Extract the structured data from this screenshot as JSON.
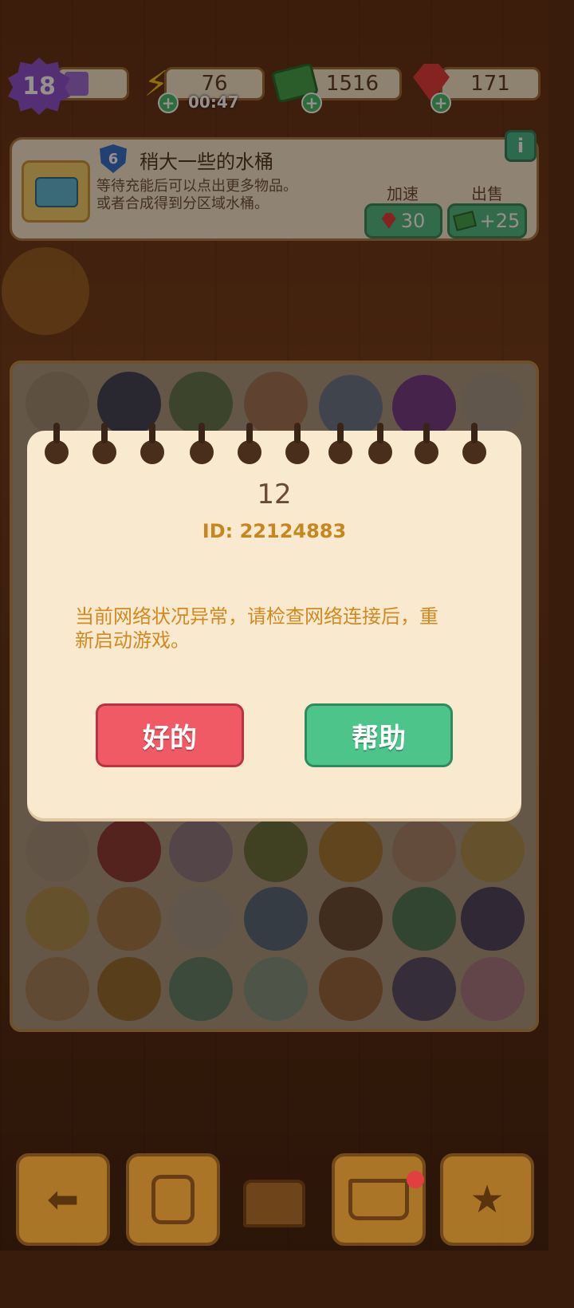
{
  "stats": {
    "level": "18",
    "energy": "76",
    "energy_timer": "00:47",
    "cash": "1516",
    "gems": "171"
  },
  "task": {
    "level": "6",
    "title": "稍大一些的水桶",
    "description_line1": "等待充能后可以点出更多物品。",
    "description_line2": "或者合成得到分区域水桶。",
    "speed_label": "加速",
    "speed_cost": "30",
    "sell_label": "出售",
    "sell_value": "+25"
  },
  "dialog": {
    "code": "12",
    "id_text": "ID: 22124883",
    "message_line1": "当前网络状况异常，请检查网络连接后，重",
    "message_line2": "新启动游戏。",
    "ok_label": "好的",
    "help_label": "帮助"
  },
  "icons": {
    "level": "star-badge-icon",
    "energy": "lightning-icon",
    "cash": "cash-stack-icon",
    "gems": "ruby-icon",
    "info": "info-icon",
    "back": "back-arrow-icon",
    "bag": "backpack-icon",
    "chest": "treasure-chest-icon",
    "basket": "basket-icon",
    "clipboard": "clipboard-star-icon"
  },
  "colors": {
    "ok_button": "#f05a64",
    "help_button": "#4cc48a",
    "dialog_bg": "#f9e9cf",
    "message_text": "#d18a22"
  }
}
